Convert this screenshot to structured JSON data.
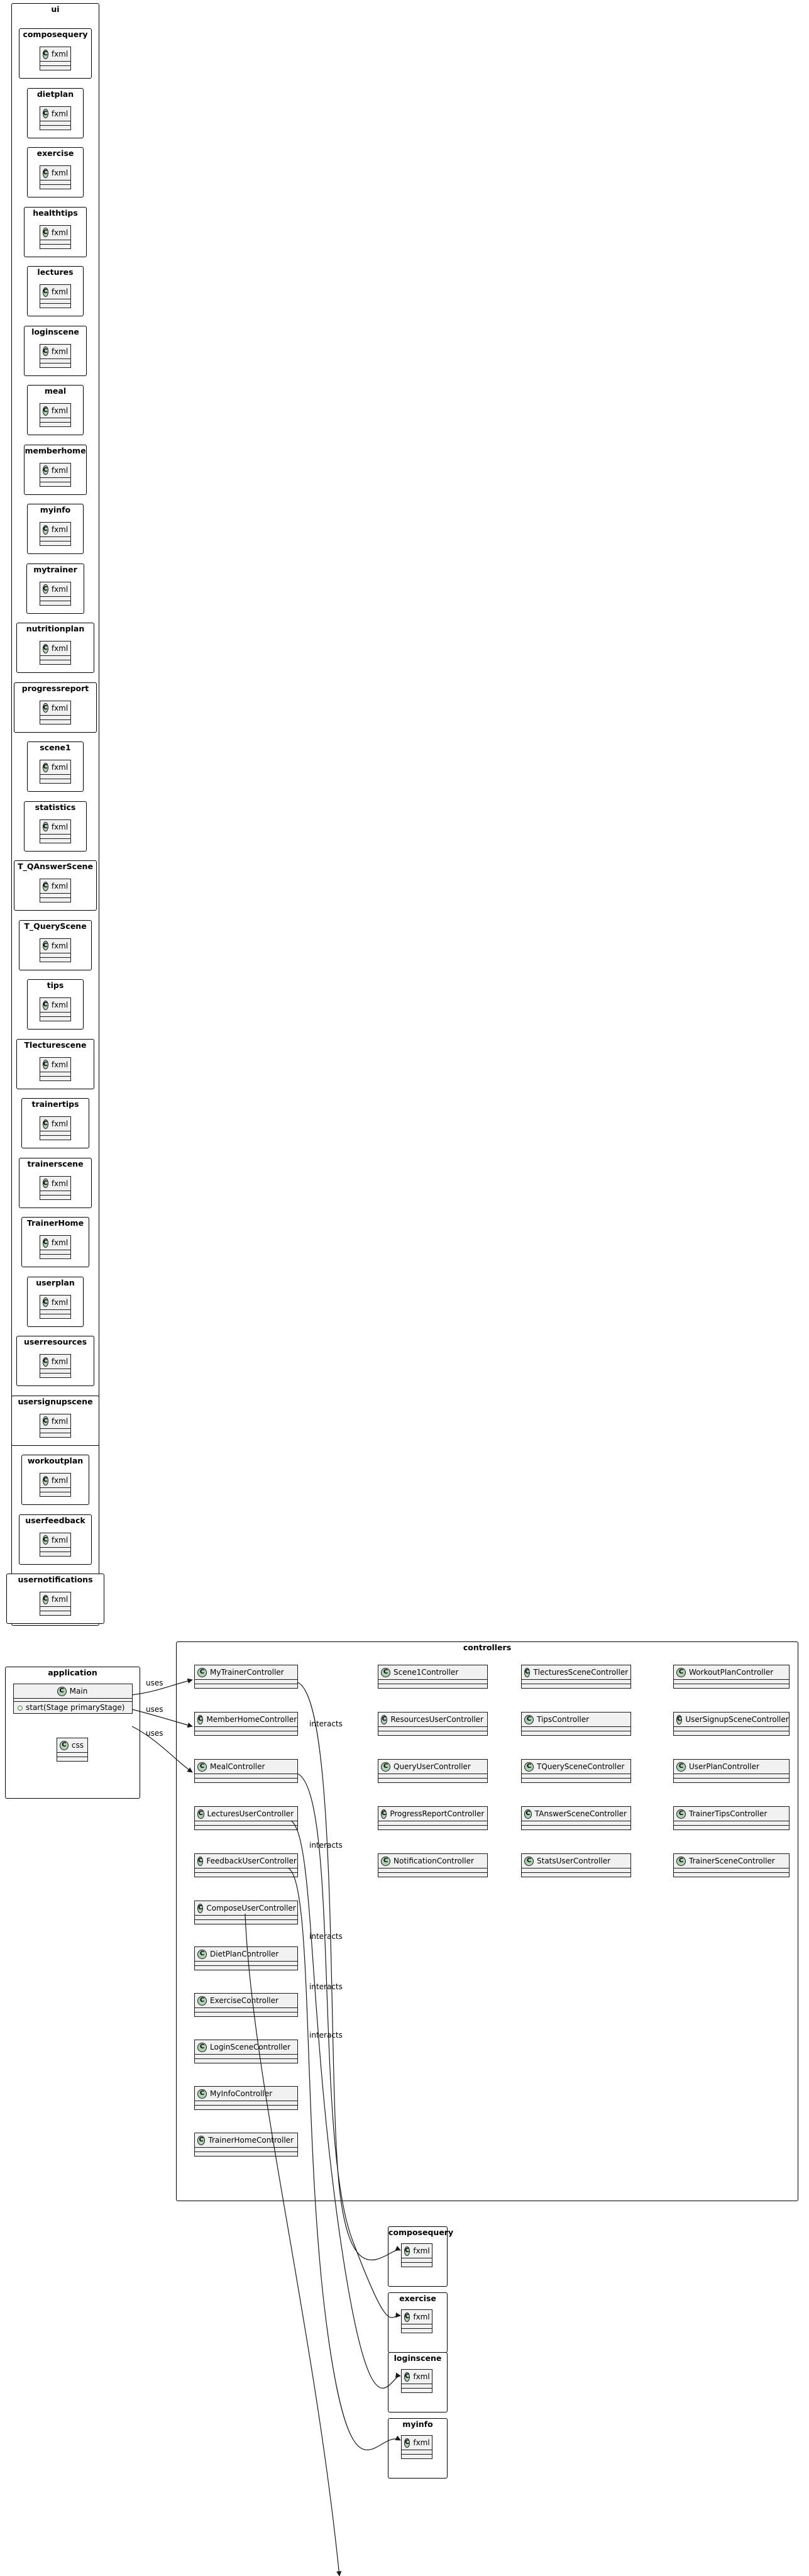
{
  "ui_package": {
    "title": "ui",
    "subpackages": [
      {
        "name": "composequery",
        "class": "fxml"
      },
      {
        "name": "dietplan",
        "class": "fxml"
      },
      {
        "name": "exercise",
        "class": "fxml"
      },
      {
        "name": "healthtips",
        "class": "fxml"
      },
      {
        "name": "lectures",
        "class": "fxml"
      },
      {
        "name": "loginscene",
        "class": "fxml"
      },
      {
        "name": "meal",
        "class": "fxml"
      },
      {
        "name": "memberhome",
        "class": "fxml"
      },
      {
        "name": "myinfo",
        "class": "fxml"
      },
      {
        "name": "mytrainer",
        "class": "fxml"
      },
      {
        "name": "nutritionplan",
        "class": "fxml"
      },
      {
        "name": "progressreport",
        "class": "fxml"
      },
      {
        "name": "scene1",
        "class": "fxml"
      },
      {
        "name": "statistics",
        "class": "fxml"
      },
      {
        "name": "T_QAnswerScene",
        "class": "fxml"
      },
      {
        "name": "T_QueryScene",
        "class": "fxml"
      },
      {
        "name": "tips",
        "class": "fxml"
      },
      {
        "name": "Tlecturescene",
        "class": "fxml"
      },
      {
        "name": "trainertips",
        "class": "fxml"
      },
      {
        "name": "trainerscene",
        "class": "fxml"
      },
      {
        "name": "TrainerHome",
        "class": "fxml"
      },
      {
        "name": "userplan",
        "class": "fxml"
      },
      {
        "name": "userresources",
        "class": "fxml"
      },
      {
        "name": "usersignupscene",
        "class": "fxml"
      },
      {
        "name": "workoutplan",
        "class": "fxml"
      },
      {
        "name": "userfeedback",
        "class": "fxml"
      },
      {
        "name": "usernotifications",
        "class": "fxml"
      }
    ]
  },
  "application_package": {
    "title": "application",
    "main_class": {
      "name": "Main",
      "method": "start(Stage primaryStage)"
    },
    "css_class": {
      "name": "css"
    }
  },
  "controllers_package": {
    "title": "controllers",
    "grid_rows": [
      [
        "MyTrainerController",
        "Scene1Controller",
        "TlecturesSceneController",
        "WorkoutPlanController"
      ],
      [
        "MemberHomeController",
        "ResourcesUserController",
        "TipsController",
        "UserSignupSceneController"
      ],
      [
        "MealController",
        "QueryUserController",
        "TQuerySceneController",
        "UserPlanController"
      ],
      [
        "LecturesUserController",
        "ProgressReportController",
        "TAnswerSceneController",
        "TrainerTipsController"
      ],
      [
        "FeedbackUserController",
        "NotificationController",
        "StatsUserController",
        "TrainerSceneController"
      ]
    ],
    "left_column": [
      "ComposeUserController",
      "DietPlanController",
      "ExerciseController",
      "LoginSceneController",
      "MyInfoController",
      "TrainerHomeController"
    ]
  },
  "bottom_packages": [
    {
      "name": "composequery",
      "class": "fxml"
    },
    {
      "name": "exercise",
      "class": "fxml"
    },
    {
      "name": "loginscene",
      "class": "fxml"
    },
    {
      "name": "myinfo",
      "class": "fxml"
    }
  ],
  "edges": {
    "uses_label": "uses",
    "interacts_label": "interacts"
  },
  "icons": {
    "class_icon": "class-c-icon"
  },
  "colors": {
    "class_fill": "#f1f1f1",
    "class_icon_fill": "#add1b2",
    "border": "#181818"
  }
}
